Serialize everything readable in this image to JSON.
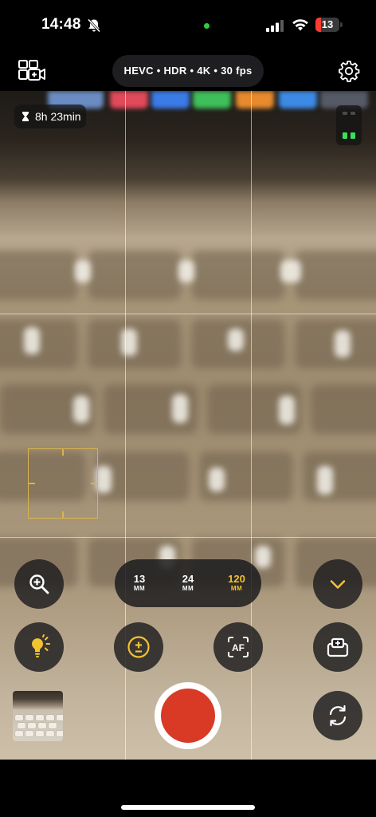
{
  "status_bar": {
    "time": "14:48",
    "battery_level": "13",
    "battery_color": "#ff3b30",
    "icons": [
      "bell-slash-icon",
      "signal-icon",
      "wifi-icon",
      "battery-icon"
    ]
  },
  "top_bar": {
    "format_label": "HEVC • HDR • 4K • 30 fps",
    "icons": [
      "multicam-icon",
      "settings-icon"
    ]
  },
  "viewfinder": {
    "remaining_time": "8h 23min",
    "focus_color": "#d9b44a"
  },
  "controls": {
    "lenses": [
      {
        "value": "13",
        "unit": "MM",
        "active": false
      },
      {
        "value": "24",
        "unit": "MM",
        "active": false
      },
      {
        "value": "120",
        "unit": "MM",
        "active": true
      }
    ],
    "accent_color": "#f2c230",
    "af_label": "AF",
    "exposure_label": "±",
    "record_color": "#d93a25",
    "icons": [
      "zoom-icon",
      "chevron-down-icon",
      "light-bulb-icon",
      "exposure-icon",
      "af-icon",
      "stabilization-icon",
      "flip-camera-icon"
    ]
  }
}
